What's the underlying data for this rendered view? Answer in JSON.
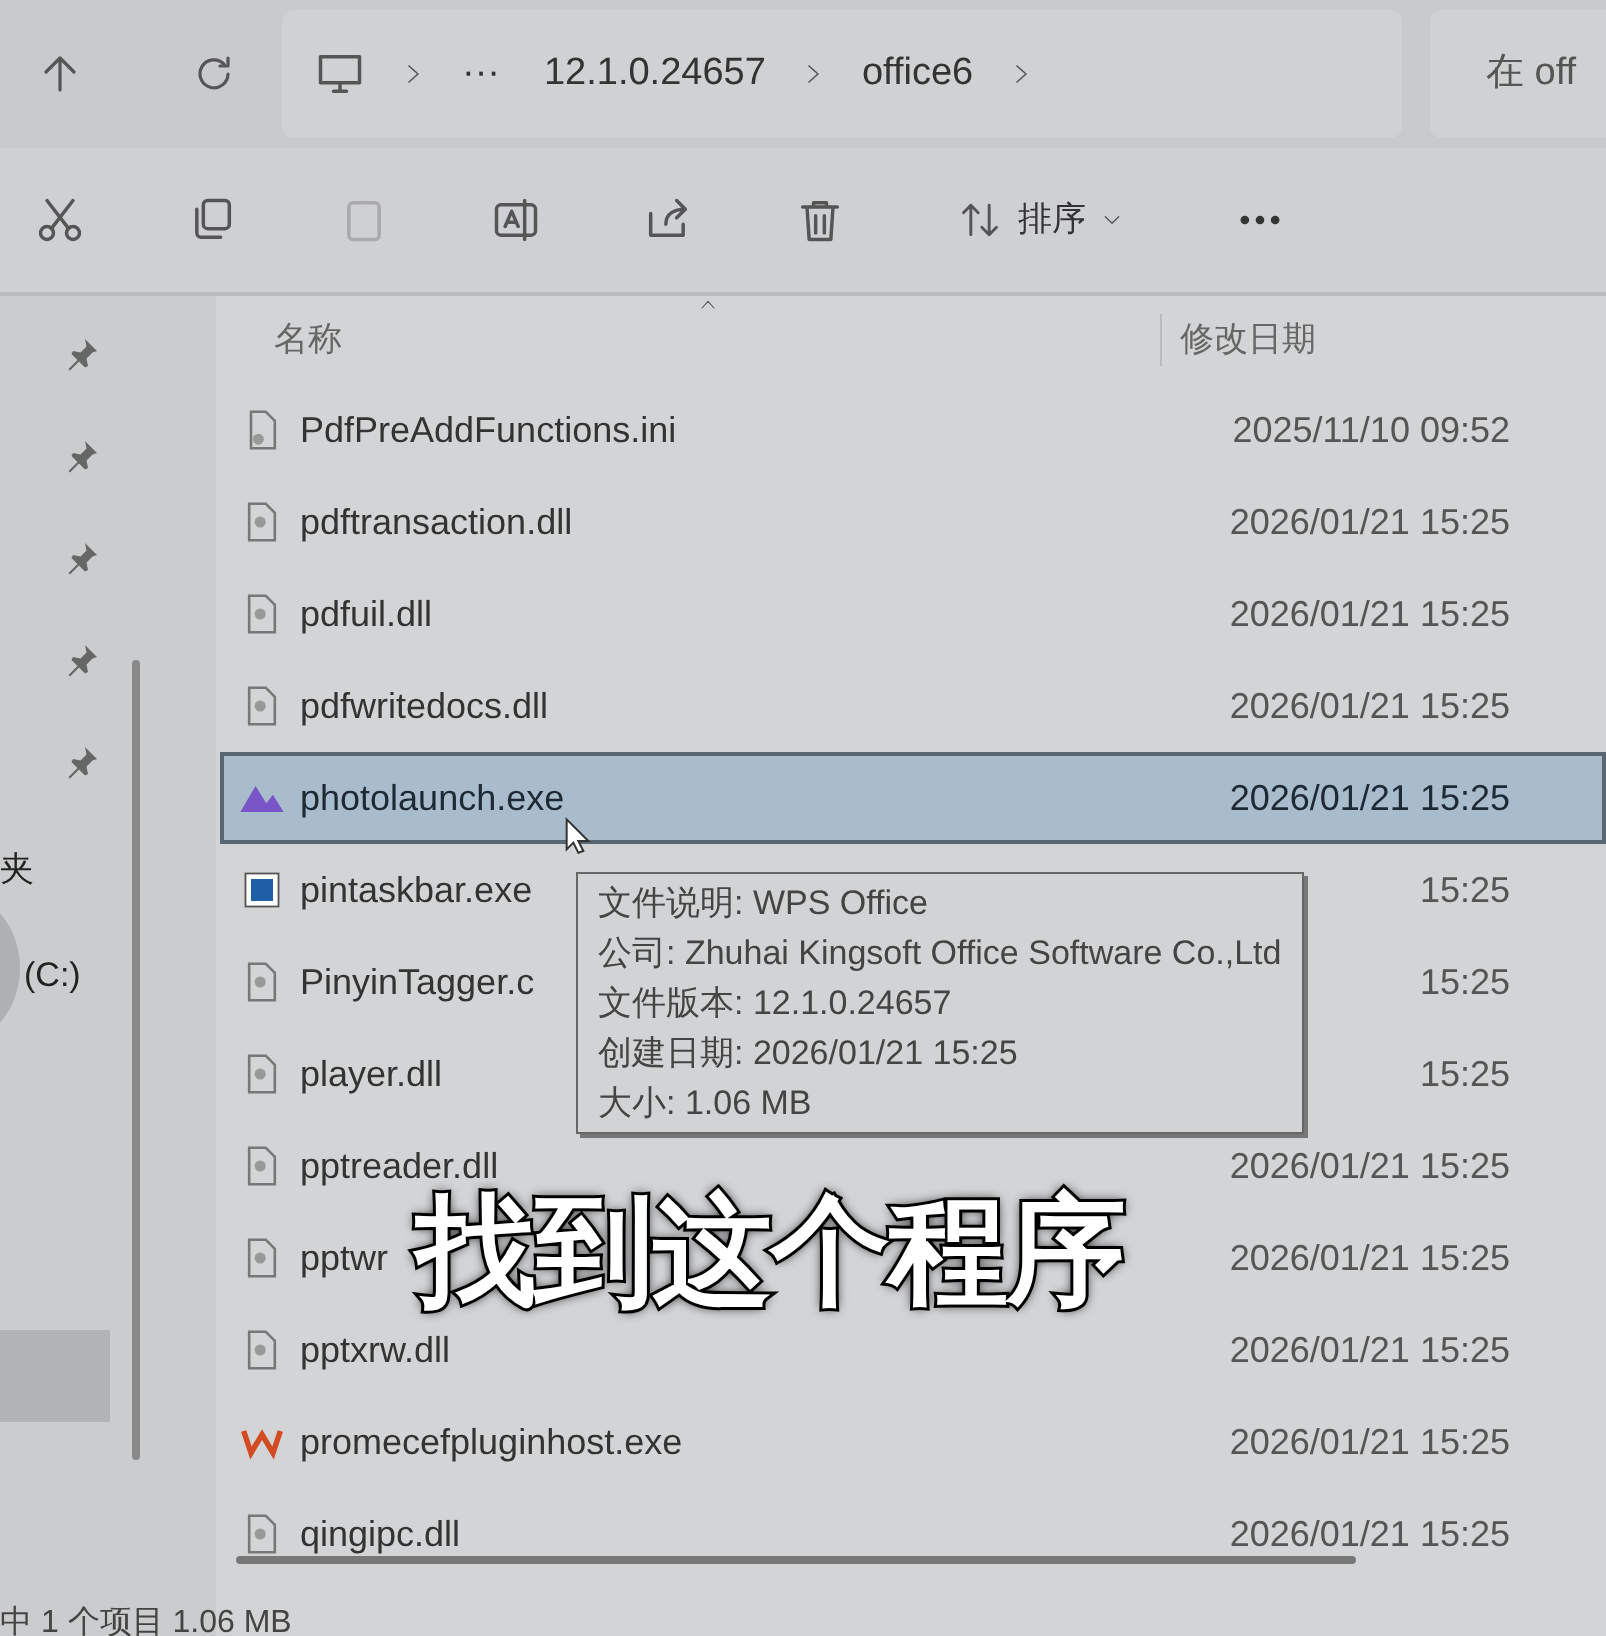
{
  "nav": {
    "breadcrumb": [
      "···",
      "12.1.0.24657",
      "office6"
    ],
    "search": {
      "placeholder": "在 off"
    }
  },
  "toolbar": {
    "sort_label": "排序"
  },
  "sidebar": {
    "items": [
      "夹",
      "(C:)"
    ]
  },
  "columns": [
    "名称",
    "修改日期"
  ],
  "rows": [
    {
      "name": "PdfPreAddFunctions.ini",
      "date": "2025/11/10 09:52",
      "kind": "ini",
      "selected": false
    },
    {
      "name": "pdftransaction.dll",
      "date": "2026/01/21 15:25",
      "kind": "dll",
      "selected": false
    },
    {
      "name": "pdfuil.dll",
      "date": "2026/01/21 15:25",
      "kind": "dll",
      "selected": false
    },
    {
      "name": "pdfwritedocs.dll",
      "date": "2026/01/21 15:25",
      "kind": "dll",
      "selected": false
    },
    {
      "name": "photolaunch.exe",
      "date": "2026/01/21 15:25",
      "kind": "photo",
      "selected": true
    },
    {
      "name": "pintaskbar.exe",
      "date": "15:25",
      "kind": "app",
      "selected": false
    },
    {
      "name": "PinyinTagger.c",
      "date": "15:25",
      "kind": "dll",
      "selected": false
    },
    {
      "name": "player.dll",
      "date": "15:25",
      "kind": "dll",
      "selected": false
    },
    {
      "name": "pptreader.dll",
      "date": "2026/01/21 15:25",
      "kind": "dll",
      "selected": false
    },
    {
      "name": "pptwr",
      "date": "2026/01/21 15:25",
      "kind": "dll",
      "selected": false
    },
    {
      "name": "pptxrw.dll",
      "date": "2026/01/21 15:25",
      "kind": "dll",
      "selected": false
    },
    {
      "name": "promecefpluginhost.exe",
      "date": "2026/01/21 15:25",
      "kind": "wps",
      "selected": false
    },
    {
      "name": "qingipc.dll",
      "date": "2026/01/21 15:25",
      "kind": "dll",
      "selected": false
    }
  ],
  "tooltip": [
    "文件说明: WPS Office",
    "公司: Zhuhai Kingsoft Office Software Co.,Ltd",
    "文件版本: 12.1.0.24657",
    "创建日期: 2026/01/21 15:25",
    "大小: 1.06 MB"
  ],
  "caption": "找到这个程序",
  "status_bar": "中 1 个项目  1.06 MB"
}
